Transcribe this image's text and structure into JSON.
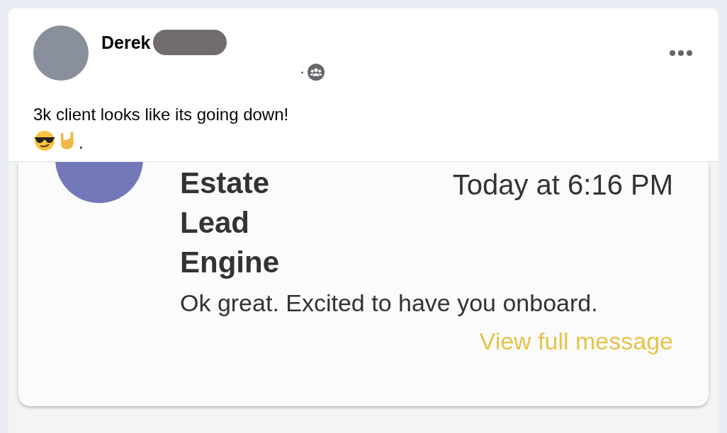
{
  "post": {
    "author": "Derek",
    "text": "3k client looks like its going down!",
    "emoji_suffix": "."
  },
  "embedded_message": {
    "title": "Estate Lead Engine",
    "time": "Today at 6:16 PM",
    "body": "Ok great. Excited to have you onboard.",
    "link": "View full message"
  }
}
